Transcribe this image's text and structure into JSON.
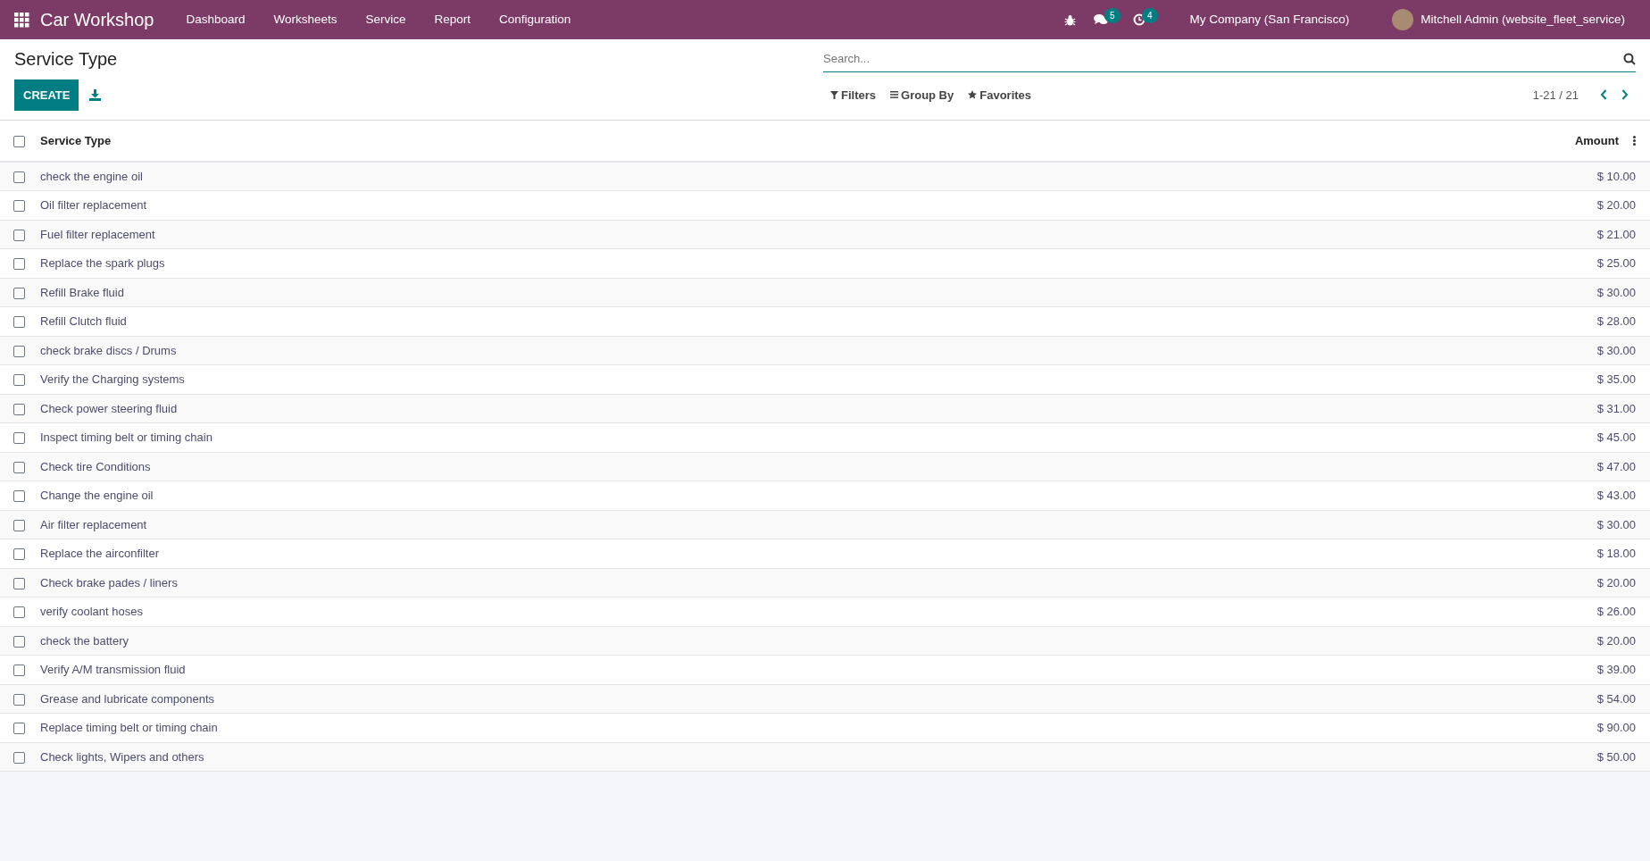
{
  "navbar": {
    "app_name": "Car Workshop",
    "menu": [
      "Dashboard",
      "Worksheets",
      "Service",
      "Report",
      "Configuration"
    ],
    "messages_count": "5",
    "activities_count": "4",
    "company": "My Company (San Francisco)",
    "user": "Mitchell Admin (website_fleet_service)"
  },
  "control_panel": {
    "title": "Service Type",
    "create_button": "CREATE",
    "search": {
      "placeholder": "Search..."
    },
    "filters": "Filters",
    "group_by": "Group By",
    "favorites": "Favorites",
    "pager": "1-21 / 21"
  },
  "table": {
    "select_all_checked": false,
    "columns": [
      "Service Type",
      "Amount"
    ],
    "rows": [
      {
        "service_type": "check the engine oil",
        "amount": "$ 10.00",
        "selected": false
      },
      {
        "service_type": "Oil filter replacement",
        "amount": "$ 20.00",
        "selected": false
      },
      {
        "service_type": "Fuel filter replacement",
        "amount": "$ 21.00",
        "selected": false
      },
      {
        "service_type": "Replace the spark plugs",
        "amount": "$ 25.00",
        "selected": false
      },
      {
        "service_type": "Refill Brake fluid",
        "amount": "$ 30.00",
        "selected": false
      },
      {
        "service_type": "Refill Clutch fluid",
        "amount": "$ 28.00",
        "selected": false
      },
      {
        "service_type": "check brake discs / Drums",
        "amount": "$ 30.00",
        "selected": false
      },
      {
        "service_type": "Verify the Charging systems",
        "amount": "$ 35.00",
        "selected": false
      },
      {
        "service_type": "Check power steering fluid",
        "amount": "$ 31.00",
        "selected": false
      },
      {
        "service_type": "Inspect timing belt or timing chain",
        "amount": "$ 45.00",
        "selected": false
      },
      {
        "service_type": "Check tire Conditions",
        "amount": "$ 47.00",
        "selected": false
      },
      {
        "service_type": "Change the engine oil",
        "amount": "$ 43.00",
        "selected": false
      },
      {
        "service_type": "Air filter replacement",
        "amount": "$ 30.00",
        "selected": false
      },
      {
        "service_type": "Replace the airconfilter",
        "amount": "$ 18.00",
        "selected": false
      },
      {
        "service_type": "Check brake pades / liners",
        "amount": "$ 20.00",
        "selected": false
      },
      {
        "service_type": "verify coolant hoses",
        "amount": "$ 26.00",
        "selected": false
      },
      {
        "service_type": "check the battery",
        "amount": "$ 20.00",
        "selected": false
      },
      {
        "service_type": "Verify A/M transmission fluid",
        "amount": "$ 39.00",
        "selected": false
      },
      {
        "service_type": "Grease and lubricate components",
        "amount": "$ 54.00",
        "selected": false
      },
      {
        "service_type": "Replace timing belt or timing chain",
        "amount": "$ 90.00",
        "selected": false
      },
      {
        "service_type": "Check lights, Wipers and others",
        "amount": "$ 50.00",
        "selected": false
      }
    ]
  }
}
